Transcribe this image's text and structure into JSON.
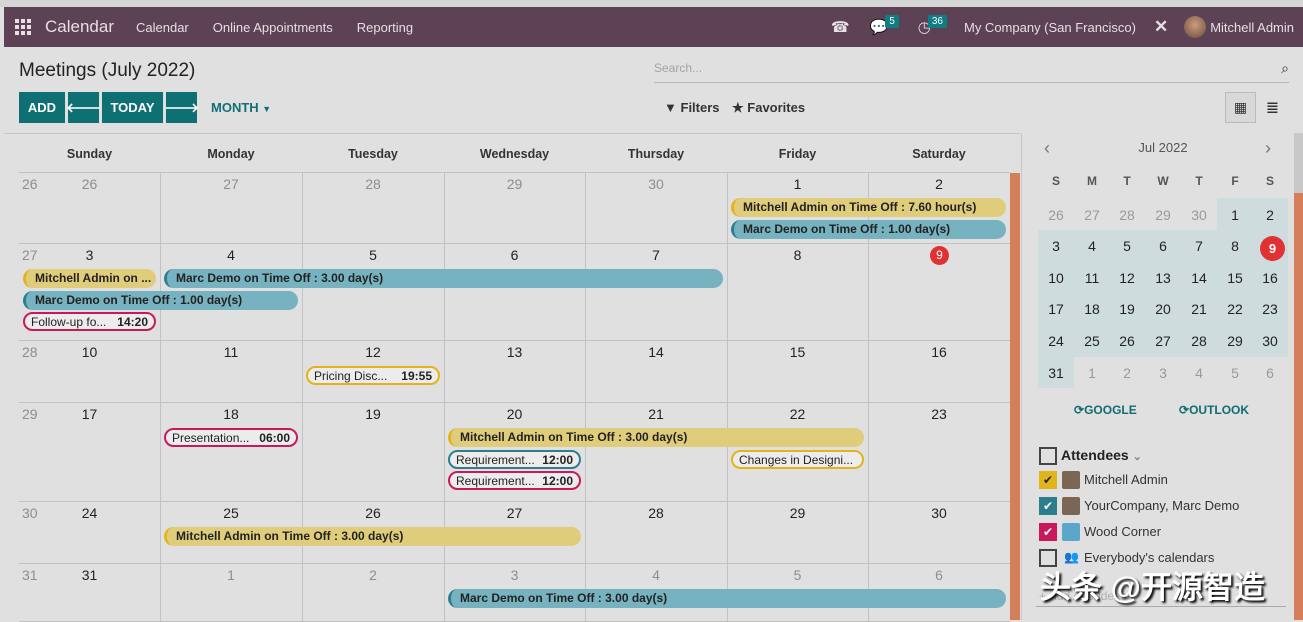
{
  "navbar": {
    "app": "Calendar",
    "menus": [
      "Calendar",
      "Online Appointments",
      "Reporting"
    ],
    "messages_count": "5",
    "activities_count": "36",
    "company": "My Company (San Francisco)",
    "user": "Mitchell Admin"
  },
  "page": {
    "title": "Meetings (July 2022)",
    "add": "ADD",
    "today": "TODAY",
    "month": "MONTH",
    "search_placeholder": "Search...",
    "filters": "Filters",
    "favorites": "Favorites"
  },
  "calendar": {
    "weekdays": [
      "Sunday",
      "Monday",
      "Tuesday",
      "Wednesday",
      "Thursday",
      "Friday",
      "Saturday"
    ],
    "weeks": [
      {
        "num": "26",
        "days": [
          "26",
          "27",
          "28",
          "29",
          "30",
          "1",
          "2"
        ],
        "out": [
          0,
          1,
          2,
          3,
          4
        ]
      },
      {
        "num": "27",
        "days": [
          "3",
          "4",
          "5",
          "6",
          "7",
          "8",
          "9"
        ],
        "out": []
      },
      {
        "num": "28",
        "days": [
          "10",
          "11",
          "12",
          "13",
          "14",
          "15",
          "16"
        ],
        "out": []
      },
      {
        "num": "29",
        "days": [
          "17",
          "18",
          "19",
          "20",
          "21",
          "22",
          "23"
        ],
        "out": []
      },
      {
        "num": "30",
        "days": [
          "24",
          "25",
          "26",
          "27",
          "28",
          "29",
          "30"
        ],
        "out": []
      },
      {
        "num": "31",
        "days": [
          "31",
          "1",
          "2",
          "3",
          "4",
          "5",
          "6"
        ],
        "out": [
          1,
          2,
          3,
          4,
          5,
          6
        ]
      }
    ],
    "today": "2022-07-09",
    "events": [
      {
        "week": 0,
        "start": 5,
        "end": 6,
        "title": "Mitchell Admin on Time Off : 7.60 hour(s)",
        "style": "y"
      },
      {
        "week": 0,
        "start": 5,
        "end": 6,
        "title": "Marc Demo on Time Off : 1.00 day(s)",
        "style": "t"
      },
      {
        "week": 1,
        "start": 0,
        "end": 0,
        "title": "Mitchell Admin on ...",
        "style": "y"
      },
      {
        "week": 1,
        "start": 1,
        "end": 4,
        "title": "Marc Demo on Time Off : 3.00 day(s)",
        "style": "t"
      },
      {
        "week": 1,
        "start": 0,
        "end": 1,
        "title": "Marc Demo on Time Off : 1.00 day(s)",
        "style": "t"
      },
      {
        "week": 1,
        "start": 0,
        "end": 0,
        "title": "Follow-up fo...",
        "time": "14:20",
        "style": "o",
        "color": "#c9185b"
      },
      {
        "week": 2,
        "start": 2,
        "end": 2,
        "title": "Pricing Disc...",
        "time": "19:55",
        "style": "o",
        "color": "#e2b41a"
      },
      {
        "week": 3,
        "start": 1,
        "end": 1,
        "title": "Presentation...",
        "time": "06:00",
        "style": "o",
        "color": "#c9185b"
      },
      {
        "week": 3,
        "start": 3,
        "end": 5,
        "title": "Mitchell Admin on Time Off : 3.00 day(s)",
        "style": "y"
      },
      {
        "week": 3,
        "start": 3,
        "end": 3,
        "title": "Requirement...",
        "time": "12:00",
        "style": "o",
        "color": "#2c7e8f"
      },
      {
        "week": 3,
        "start": 3,
        "end": 3,
        "title": "Requirement...",
        "time": "12:00",
        "style": "o",
        "color": "#c9185b"
      },
      {
        "week": 3,
        "start": 5,
        "end": 5,
        "title": "Changes in Designi...",
        "style": "o",
        "color": "#e2b41a"
      },
      {
        "week": 4,
        "start": 1,
        "end": 3,
        "title": "Mitchell Admin on Time Off : 3.00 day(s)",
        "style": "y"
      },
      {
        "week": 5,
        "start": 3,
        "end": 6,
        "title": "Marc Demo on Time Off : 3.00 day(s)",
        "style": "t"
      }
    ]
  },
  "sidebar": {
    "month": "Jul 2022",
    "weekdays": [
      "S",
      "M",
      "T",
      "W",
      "T",
      "F",
      "S"
    ],
    "days": [
      "26",
      "27",
      "28",
      "29",
      "30",
      "1",
      "2",
      "3",
      "4",
      "5",
      "6",
      "7",
      "8",
      "9",
      "10",
      "11",
      "12",
      "13",
      "14",
      "15",
      "16",
      "17",
      "18",
      "19",
      "20",
      "21",
      "22",
      "23",
      "24",
      "25",
      "26",
      "27",
      "28",
      "29",
      "30",
      "31",
      "1",
      "2",
      "3",
      "4",
      "5",
      "6"
    ],
    "google": "GOOGLE",
    "outlook": "OUTLOOK",
    "attendees_title": "Attendees",
    "attendees": [
      {
        "name": "Mitchell Admin",
        "color": "#e2b41a",
        "checked": true
      },
      {
        "name": "YourCompany, Marc Demo",
        "color": "#2c7e8f",
        "checked": true
      },
      {
        "name": "Wood Corner",
        "color": "#c9185b",
        "checked": true
      },
      {
        "name": "Everybody's calendars",
        "checked": false
      }
    ],
    "add_attendees": "+ Add Attendees"
  },
  "watermark": "头条 @开源智造"
}
